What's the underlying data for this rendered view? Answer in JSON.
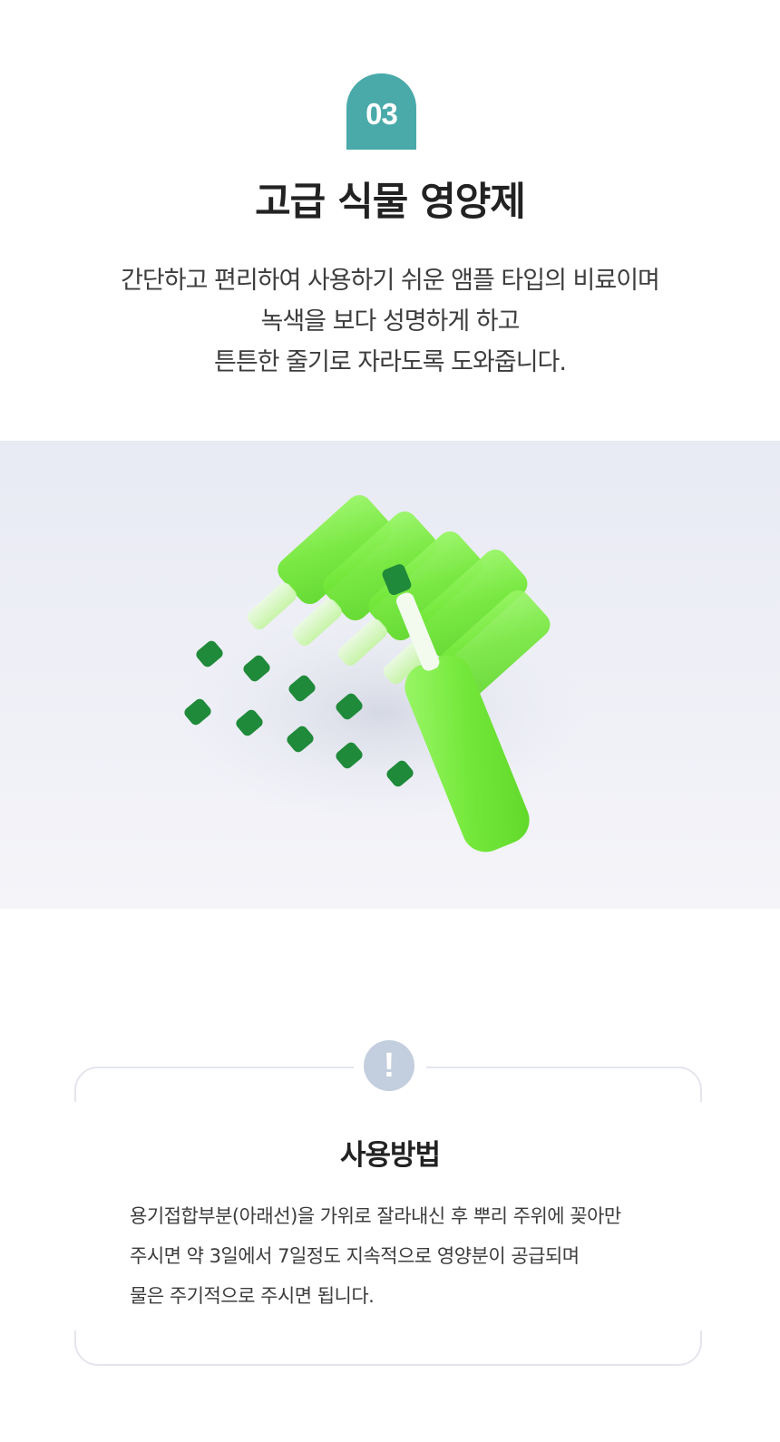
{
  "section": {
    "number": "03",
    "title": "고급 식물 영양제",
    "description": [
      "간단하고 편리하여 사용하기 쉬운 앰플 타입의 비료이며",
      "녹색을 보다 성명하게 하고",
      "튼튼한 줄기로 자라도록 도와줍니다."
    ]
  },
  "notice": {
    "icon": "exclamation-icon",
    "icon_glyph": "!",
    "icon_color": "#c3cede",
    "title": "사용방법",
    "body": [
      "용기접합부분(아래선)을 가위로 잘라내신 후 뿌리 주위에 꽂아만",
      "주시면 약 3일에서 7일정도 지속적으로 영양분이 공급되며",
      "물은 주기적으로 주시면 됩니다."
    ]
  },
  "colors": {
    "accent": "#4aa9a9",
    "ampoule_green": "#7ff03a",
    "cap_green": "#1f8a3a"
  }
}
